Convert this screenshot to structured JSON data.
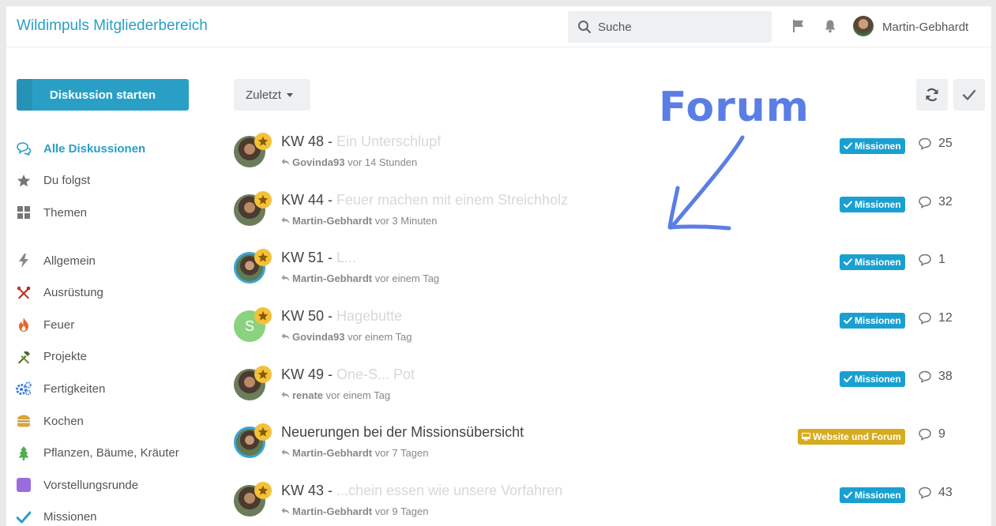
{
  "header": {
    "app_title": "Wildimpuls Mitgliederbereich",
    "search_placeholder": "Suche",
    "user_name": "Martin-Gebhardt",
    "icons": [
      "flag-icon",
      "bell-icon"
    ]
  },
  "sidebar": {
    "start_button": "Diskussion starten",
    "primary": [
      {
        "label": "Alle Diskussionen",
        "icon": "chat-bubbles-icon",
        "active": true
      },
      {
        "label": "Du folgst",
        "icon": "star-icon"
      },
      {
        "label": "Themen",
        "icon": "grid-icon"
      }
    ],
    "tags": [
      {
        "label": "Allgemein",
        "icon": "bolt-icon",
        "color": "#888888"
      },
      {
        "label": "Ausrüstung",
        "icon": "tools-icon",
        "color": "#c0392b"
      },
      {
        "label": "Feuer",
        "icon": "fire-icon",
        "color": "#e67e22"
      },
      {
        "label": "Projekte",
        "icon": "hammer-icon",
        "color": "#4a6b2a"
      },
      {
        "label": "Fertigkeiten",
        "icon": "cogs-icon",
        "color": "#3b7dd8"
      },
      {
        "label": "Kochen",
        "icon": "burger-icon",
        "color": "#d9a441"
      },
      {
        "label": "Pflanzen, Bäume, Kräuter",
        "icon": "tree-icon",
        "color": "#4caf50"
      },
      {
        "label": "Vorstellungsrunde",
        "icon": "square-icon",
        "color": "#9b6ddc"
      },
      {
        "label": "Missionen",
        "icon": "check-icon",
        "color": "#2a9fc6"
      }
    ]
  },
  "toolbar": {
    "sort_label": "Zuletzt",
    "refresh_icon": "refresh-icon",
    "mark_read_icon": "check-icon"
  },
  "annotation": {
    "text": "Forum",
    "color": "#5b7de6"
  },
  "discussions": [
    {
      "title": "KW 48 - ",
      "title_faded": "Ein Unterschlupf",
      "user": "Govinda93",
      "time": "vor 14 Stunden",
      "tag": "Missionen",
      "tag_color": "#1aa0d0",
      "replies": "25",
      "avatar": "photo"
    },
    {
      "title": "KW 44 - ",
      "title_faded": "Feuer machen mit einem Streichholz",
      "user": "Martin-Gebhardt",
      "time": "vor 3 Minuten",
      "tag": "Missionen",
      "tag_color": "#1aa0d0",
      "replies": "32",
      "avatar": "photo"
    },
    {
      "title": "KW 51 - ",
      "title_faded": "L...",
      "user": "Martin-Gebhardt",
      "time": "vor einem Tag",
      "tag": "Missionen",
      "tag_color": "#1aa0d0",
      "replies": "1",
      "avatar": "ring"
    },
    {
      "title": "KW 50 - ",
      "title_faded": "Hagebutte",
      "user": "Govinda93",
      "time": "vor einem Tag",
      "tag": "Missionen",
      "tag_color": "#1aa0d0",
      "replies": "12",
      "avatar": "letter",
      "avatar_letter": "S"
    },
    {
      "title": "KW 49 - ",
      "title_faded": "One-S... Pot",
      "user": "renate",
      "time": "vor einem Tag",
      "tag": "Missionen",
      "tag_color": "#1aa0d0",
      "replies": "38",
      "avatar": "photo"
    },
    {
      "title": "Neuerungen bei der Missionsübersicht",
      "title_faded": "",
      "user": "Martin-Gebhardt",
      "time": "vor 7 Tagen",
      "tag": "Website und Forum",
      "tag_color": "#d7ab1e",
      "replies": "9",
      "avatar": "ring"
    },
    {
      "title": "KW 43 - ",
      "title_faded": "...chein essen wie unsere Vorfahren",
      "user": "Martin-Gebhardt",
      "time": "vor 9 Tagen",
      "tag": "Missionen",
      "tag_color": "#1aa0d0",
      "replies": "43",
      "avatar": "photo"
    }
  ]
}
